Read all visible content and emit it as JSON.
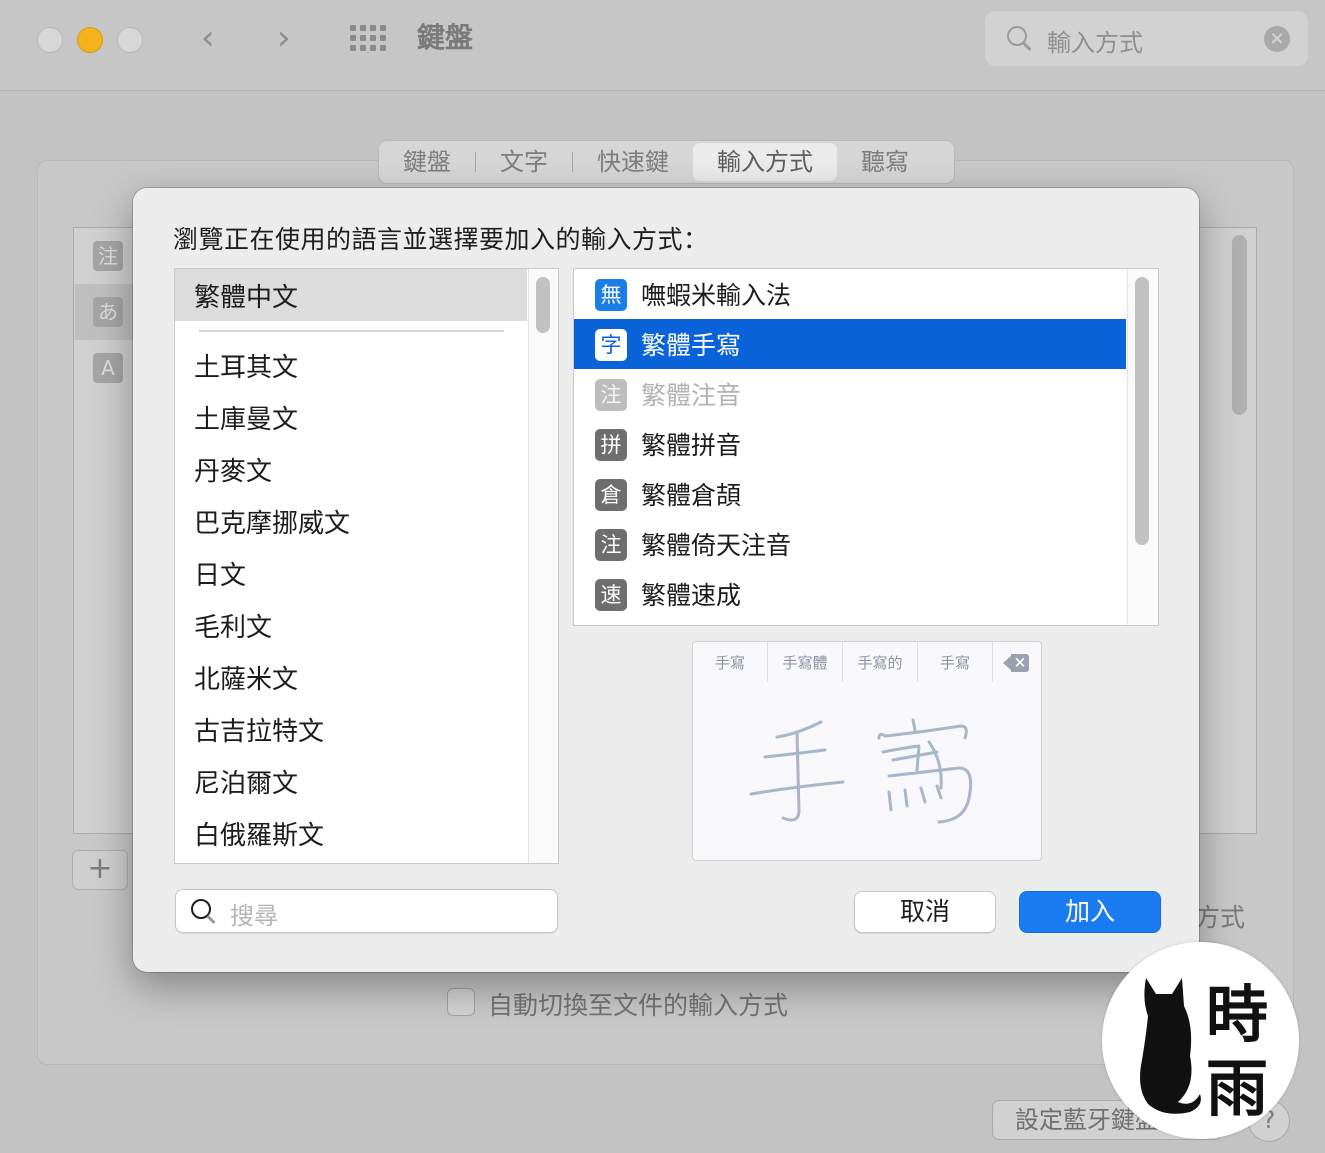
{
  "window": {
    "title": "鍵盤",
    "search_value": "輸入方式",
    "nav_back": "‹",
    "nav_forward": "›",
    "clear_symbol": "×"
  },
  "tabs": [
    {
      "label": "鍵盤",
      "selected": false
    },
    {
      "label": "文字",
      "selected": false
    },
    {
      "label": "快速鍵",
      "selected": false
    },
    {
      "label": "輸入方式",
      "selected": true
    },
    {
      "label": "聽寫",
      "selected": false
    }
  ],
  "background": {
    "list_icons": [
      "注",
      "あ",
      "A"
    ],
    "add_symbol": "+",
    "right_text_fragment": "方式",
    "auto_switch_label": "自動切換至文件的輸入方式",
    "bluetooth_button": "設定藍牙鍵盤",
    "help_symbol": "?"
  },
  "dialog": {
    "prompt": "瀏覽正在使用的語言並選擇要加入的輸入方式：",
    "languages": [
      {
        "label": "繁體中文",
        "selected": true
      },
      {
        "label": "土耳其文"
      },
      {
        "label": "土庫曼文"
      },
      {
        "label": "丹麥文"
      },
      {
        "label": "巴克摩挪威文"
      },
      {
        "label": "日文"
      },
      {
        "label": "毛利文"
      },
      {
        "label": "北薩米文"
      },
      {
        "label": "古吉拉特文"
      },
      {
        "label": "尼泊爾文"
      },
      {
        "label": "白俄羅斯文"
      }
    ],
    "input_methods": [
      {
        "icon": "無",
        "label": "嘸蝦米輸入法",
        "state": "normal",
        "icon_style": "blue"
      },
      {
        "icon": "字",
        "label": "繁體手寫",
        "state": "selected"
      },
      {
        "icon": "注",
        "label": "繁體注音",
        "state": "disabled"
      },
      {
        "icon": "拼",
        "label": "繁體拼音",
        "state": "normal"
      },
      {
        "icon": "倉",
        "label": "繁體倉頡",
        "state": "normal"
      },
      {
        "icon": "注",
        "label": "繁體倚天注音",
        "state": "normal"
      },
      {
        "icon": "速",
        "label": "繁體速成",
        "state": "normal"
      }
    ],
    "preview": {
      "candidates": [
        "手寫",
        "手寫體",
        "手寫的",
        "手寫"
      ],
      "handwriting": "手寫",
      "delete_icon": "delete-key-icon"
    },
    "search_placeholder": "搜尋",
    "cancel_label": "取消",
    "add_label": "加入"
  },
  "watermark": {
    "line1": "時",
    "line2": "雨"
  },
  "colors": {
    "accent": "#1a7cf0",
    "selection": "#0b63d9",
    "minimize_light": "#f4b31c"
  }
}
